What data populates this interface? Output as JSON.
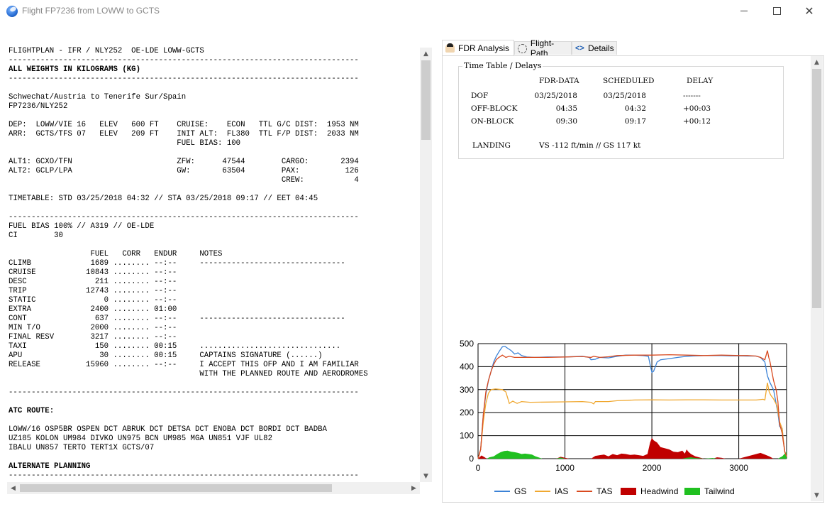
{
  "window": {
    "title": "Flight FP7236 from LOWW to GCTS"
  },
  "ofp": {
    "lines": [
      "FLIGHTPLAN - IFR / NLY252  OE-LDE LOWW-GCTS",
      "-----------------------------------------------------------------------------",
      "ALL WEIGHTS IN KILOGRAMS (KG)",
      "-----------------------------------------------------------------------------",
      "",
      "Schwechat/Austria to Tenerife Sur/Spain",
      "FP7236/NLY252",
      "",
      "DEP:  LOWW/VIE 16   ELEV   600 FT    CRUISE:    ECON   TTL G/C DIST:  1953 NM",
      "ARR:  GCTS/TFS 07   ELEV   209 FT    INIT ALT:  FL380  TTL F/P DIST:  2033 NM",
      "                                     FUEL BIAS: 100",
      "",
      "ALT1: GCXO/TFN                       ZFW:      47544        CARGO:       2394",
      "ALT2: GCLP/LPA                       GW:       63504        PAX:          126",
      "                                                            CREW:           4",
      "",
      "TIMETABLE: STD 03/25/2018 04:32 // STA 03/25/2018 09:17 // EET 04:45",
      "",
      "-----------------------------------------------------------------------------",
      "FUEL BIAS 100% // A319 // OE-LDE",
      "CI        30",
      "",
      "                  FUEL   CORR   ENDUR     NOTES",
      "CLIMB             1689 ........ --:--     --------------------------------",
      "CRUISE           10843 ........ --:--",
      "DESC               211 ........ --:--",
      "TRIP             12743 ........ --:--",
      "STATIC               0 ........ --:--",
      "EXTRA             2400 ........ 01:00",
      "CONT               637 ........ --:--     --------------------------------",
      "MIN T/O           2000 ........ --:--",
      "FINAL RESV        3217 ........ --:--",
      "TAXI               150 ........ 00:15     ...............................",
      "APU                 30 ........ 00:15     CAPTAINS SIGNATURE (......)",
      "RELEASE          15960 ........ --:--     I ACCEPT THIS OFP AND I AM FAMILIAR",
      "                                          WITH THE PLANNED ROUTE AND AERODROMES",
      "",
      "-----------------------------------------------------------------------------",
      "",
      "ATC ROUTE:",
      "",
      "LOWW/16 OSP5BR OSPEN DCT ABRUK DCT DETSA DCT ENOBA DCT BORDI DCT BADBA",
      "UZ185 KOLON UM984 DIVKO UN975 BCN UM985 MGA UN851 VJF UL82",
      "IBALU UN857 TERTO TERT1X GCTS/07",
      "",
      "ALTERNATE PLANNING",
      "-----------------------------------------------------------------------------"
    ],
    "bold_lines": [
      "ALL WEIGHTS IN KILOGRAMS (KG)",
      "ATC ROUTE:",
      "ALTERNATE PLANNING"
    ]
  },
  "tabs": [
    {
      "label": "FDR Analysis",
      "icon": "pilot-icon"
    },
    {
      "label": "Flight-Path",
      "icon": "flight-path-icon"
    },
    {
      "label": "Details",
      "icon": "details-icon"
    }
  ],
  "timetable": {
    "title": "Time Table / Delays",
    "headers": [
      "FDR-DATA",
      "SCHEDULED",
      "DELAY"
    ],
    "rows": [
      {
        "label": "DOF",
        "fdr": "03/25/2018",
        "scheduled": "03/25/2018",
        "delay": "-------"
      },
      {
        "label": "OFF-BLOCK",
        "fdr": "04:35",
        "scheduled": "04:32",
        "delay": "+00:03"
      },
      {
        "label": "ON-BLOCK",
        "fdr": "09:30",
        "scheduled": "09:17",
        "delay": "+00:12"
      }
    ],
    "landing_label": "LANDING",
    "landing_value": "VS -112 ft/min // GS 117 kt"
  },
  "chart_data": {
    "type": "line",
    "xlim": [
      0,
      3550
    ],
    "ylim": [
      0,
      500
    ],
    "x_ticks": [
      0,
      1000,
      2000,
      3000
    ],
    "y_ticks": [
      0,
      100,
      200,
      300,
      400,
      500
    ],
    "grid": true,
    "legend_position": "bottom",
    "series": [
      {
        "name": "GS",
        "color": "#3b82d6",
        "kind": "line",
        "points": [
          [
            0,
            0
          ],
          [
            30,
            40
          ],
          [
            60,
            190
          ],
          [
            90,
            280
          ],
          [
            120,
            340
          ],
          [
            150,
            380
          ],
          [
            180,
            420
          ],
          [
            210,
            445
          ],
          [
            250,
            470
          ],
          [
            280,
            486
          ],
          [
            310,
            488
          ],
          [
            340,
            480
          ],
          [
            380,
            470
          ],
          [
            420,
            455
          ],
          [
            460,
            460
          ],
          [
            500,
            448
          ],
          [
            560,
            442
          ],
          [
            650,
            440
          ],
          [
            800,
            442
          ],
          [
            1000,
            442
          ],
          [
            1200,
            445
          ],
          [
            1280,
            440
          ],
          [
            1300,
            430
          ],
          [
            1350,
            432
          ],
          [
            1400,
            440
          ],
          [
            1500,
            438
          ],
          [
            1600,
            445
          ],
          [
            1700,
            450
          ],
          [
            1800,
            450
          ],
          [
            1900,
            448
          ],
          [
            1960,
            445
          ],
          [
            1985,
            400
          ],
          [
            2000,
            375
          ],
          [
            2020,
            380
          ],
          [
            2040,
            400
          ],
          [
            2060,
            420
          ],
          [
            2100,
            430
          ],
          [
            2200,
            435
          ],
          [
            2300,
            440
          ],
          [
            2400,
            445
          ],
          [
            2500,
            447
          ],
          [
            2600,
            448
          ],
          [
            2700,
            448
          ],
          [
            2800,
            448
          ],
          [
            2900,
            447
          ],
          [
            3000,
            447
          ],
          [
            3100,
            446
          ],
          [
            3200,
            446
          ],
          [
            3250,
            440
          ],
          [
            3300,
            420
          ],
          [
            3330,
            360
          ],
          [
            3360,
            330
          ],
          [
            3400,
            300
          ],
          [
            3450,
            200
          ],
          [
            3470,
            140
          ],
          [
            3500,
            130
          ],
          [
            3510,
            90
          ],
          [
            3530,
            30
          ],
          [
            3550,
            10
          ]
        ]
      },
      {
        "name": "IAS",
        "color": "#f0a830",
        "kind": "line",
        "points": [
          [
            0,
            0
          ],
          [
            30,
            40
          ],
          [
            60,
            160
          ],
          [
            90,
            240
          ],
          [
            120,
            285
          ],
          [
            150,
            300
          ],
          [
            200,
            303
          ],
          [
            280,
            300
          ],
          [
            320,
            290
          ],
          [
            360,
            240
          ],
          [
            400,
            250
          ],
          [
            450,
            240
          ],
          [
            500,
            248
          ],
          [
            600,
            245
          ],
          [
            800,
            246
          ],
          [
            1000,
            247
          ],
          [
            1200,
            248
          ],
          [
            1300,
            245
          ],
          [
            1330,
            238
          ],
          [
            1350,
            248
          ],
          [
            1500,
            248
          ],
          [
            1600,
            252
          ],
          [
            1800,
            255
          ],
          [
            2000,
            256
          ],
          [
            2200,
            255
          ],
          [
            2400,
            256
          ],
          [
            2600,
            256
          ],
          [
            2800,
            255
          ],
          [
            3000,
            255
          ],
          [
            3200,
            255
          ],
          [
            3280,
            258
          ],
          [
            3300,
            255
          ],
          [
            3330,
            330
          ],
          [
            3350,
            290
          ],
          [
            3370,
            275
          ],
          [
            3400,
            260
          ],
          [
            3440,
            230
          ],
          [
            3470,
            160
          ],
          [
            3500,
            130
          ],
          [
            3510,
            90
          ],
          [
            3530,
            30
          ],
          [
            3550,
            10
          ]
        ]
      },
      {
        "name": "TAS",
        "color": "#d94a1f",
        "kind": "line",
        "points": [
          [
            0,
            0
          ],
          [
            30,
            40
          ],
          [
            60,
            190
          ],
          [
            90,
            290
          ],
          [
            120,
            340
          ],
          [
            150,
            380
          ],
          [
            180,
            410
          ],
          [
            210,
            430
          ],
          [
            240,
            440
          ],
          [
            280,
            450
          ],
          [
            320,
            440
          ],
          [
            360,
            445
          ],
          [
            420,
            440
          ],
          [
            500,
            440
          ],
          [
            600,
            440
          ],
          [
            800,
            440
          ],
          [
            1000,
            442
          ],
          [
            1200,
            444
          ],
          [
            1300,
            440
          ],
          [
            1330,
            445
          ],
          [
            1400,
            440
          ],
          [
            1500,
            443
          ],
          [
            1600,
            448
          ],
          [
            1800,
            450
          ],
          [
            2000,
            450
          ],
          [
            2200,
            452
          ],
          [
            2400,
            450
          ],
          [
            2600,
            448
          ],
          [
            2800,
            450
          ],
          [
            3000,
            448
          ],
          [
            3100,
            448
          ],
          [
            3200,
            446
          ],
          [
            3250,
            440
          ],
          [
            3300,
            430
          ],
          [
            3330,
            470
          ],
          [
            3345,
            440
          ],
          [
            3360,
            420
          ],
          [
            3400,
            340
          ],
          [
            3430,
            300
          ],
          [
            3450,
            250
          ],
          [
            3470,
            150
          ],
          [
            3500,
            110
          ],
          [
            3510,
            80
          ],
          [
            3530,
            30
          ],
          [
            3550,
            10
          ]
        ]
      },
      {
        "name": "Headwind",
        "color": "#c00000",
        "kind": "area",
        "points": [
          [
            0,
            0
          ],
          [
            40,
            14
          ],
          [
            80,
            5
          ],
          [
            100,
            0
          ],
          [
            600,
            0
          ],
          [
            650,
            4
          ],
          [
            700,
            0
          ],
          [
            900,
            0
          ],
          [
            950,
            8
          ],
          [
            1000,
            4
          ],
          [
            1050,
            0
          ],
          [
            1300,
            0
          ],
          [
            1350,
            12
          ],
          [
            1400,
            15
          ],
          [
            1450,
            18
          ],
          [
            1500,
            10
          ],
          [
            1550,
            20
          ],
          [
            1600,
            15
          ],
          [
            1650,
            22
          ],
          [
            1700,
            20
          ],
          [
            1750,
            16
          ],
          [
            1800,
            18
          ],
          [
            1850,
            15
          ],
          [
            1900,
            12
          ],
          [
            1950,
            20
          ],
          [
            1980,
            70
          ],
          [
            2000,
            90
          ],
          [
            2020,
            80
          ],
          [
            2040,
            75
          ],
          [
            2060,
            70
          ],
          [
            2080,
            60
          ],
          [
            2100,
            50
          ],
          [
            2150,
            45
          ],
          [
            2200,
            40
          ],
          [
            2250,
            30
          ],
          [
            2300,
            28
          ],
          [
            2350,
            35
          ],
          [
            2380,
            22
          ],
          [
            2400,
            40
          ],
          [
            2420,
            30
          ],
          [
            2450,
            20
          ],
          [
            2500,
            10
          ],
          [
            2550,
            5
          ],
          [
            2600,
            0
          ],
          [
            2700,
            0
          ],
          [
            2750,
            6
          ],
          [
            2800,
            4
          ],
          [
            2850,
            0
          ],
          [
            3000,
            0
          ],
          [
            3050,
            5
          ],
          [
            3100,
            10
          ],
          [
            3150,
            15
          ],
          [
            3200,
            20
          ],
          [
            3250,
            25
          ],
          [
            3300,
            18
          ],
          [
            3350,
            10
          ],
          [
            3400,
            0
          ],
          [
            3550,
            0
          ]
        ]
      },
      {
        "name": "Tailwind",
        "color": "#20c020",
        "kind": "area",
        "points": [
          [
            0,
            0
          ],
          [
            100,
            0
          ],
          [
            130,
            6
          ],
          [
            180,
            10
          ],
          [
            220,
            20
          ],
          [
            260,
            28
          ],
          [
            300,
            33
          ],
          [
            340,
            35
          ],
          [
            380,
            30
          ],
          [
            420,
            28
          ],
          [
            460,
            25
          ],
          [
            500,
            20
          ],
          [
            540,
            22
          ],
          [
            580,
            20
          ],
          [
            620,
            18
          ],
          [
            660,
            10
          ],
          [
            700,
            5
          ],
          [
            740,
            0
          ],
          [
            900,
            0
          ],
          [
            950,
            5
          ],
          [
            1000,
            0
          ],
          [
            2350,
            0
          ],
          [
            2400,
            4
          ],
          [
            2450,
            6
          ],
          [
            2500,
            3
          ],
          [
            2600,
            0
          ],
          [
            2700,
            3
          ],
          [
            2750,
            0
          ],
          [
            3450,
            0
          ],
          [
            3500,
            10
          ],
          [
            3550,
            30
          ]
        ]
      }
    ]
  },
  "scroll": {
    "up": "▲",
    "down": "▼",
    "left": "◀",
    "right": "▶"
  }
}
